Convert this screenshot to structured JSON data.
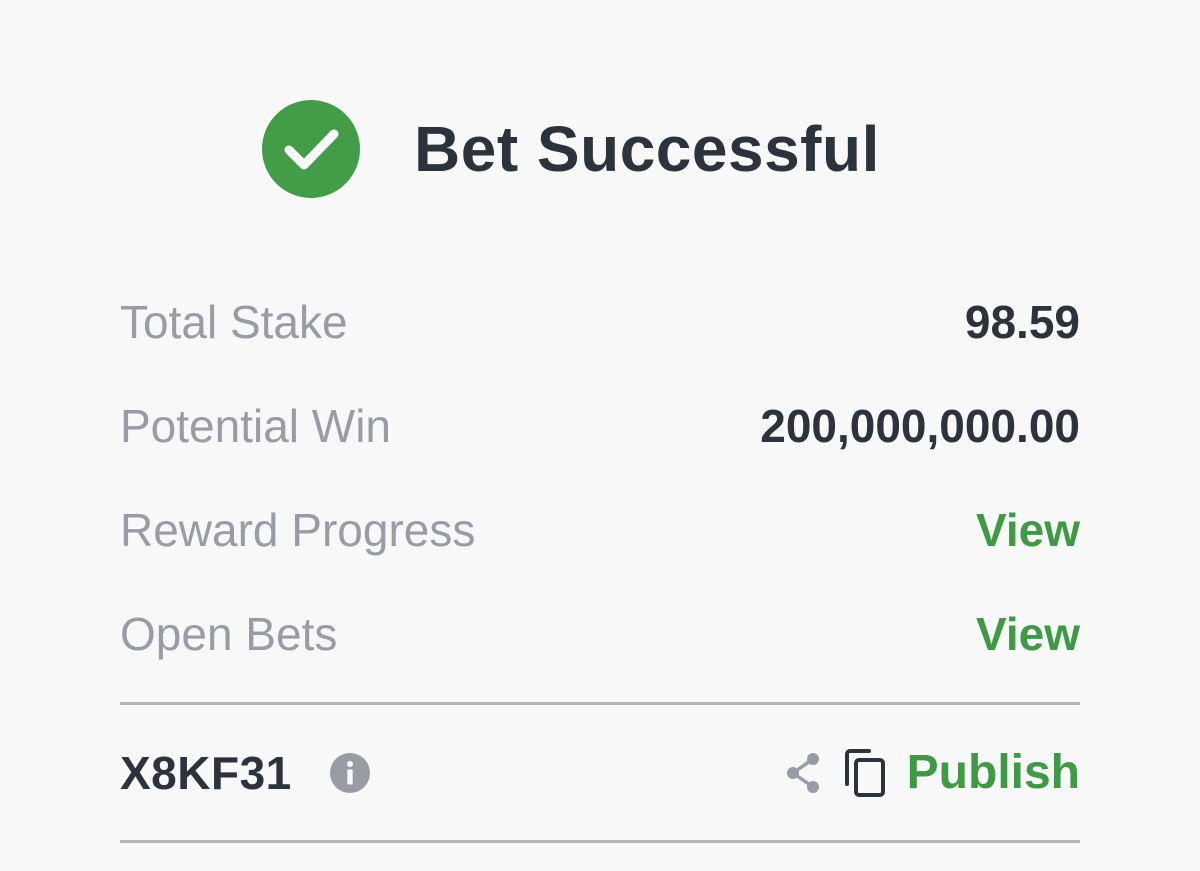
{
  "colors": {
    "accent": "#3e9a45",
    "text_dark": "#2d333d",
    "text_muted": "#9a9ca5",
    "background": "#f8f8f9"
  },
  "header": {
    "icon": "check-circle-icon",
    "title": "Bet Successful"
  },
  "summary": {
    "rows": [
      {
        "label": "Total Stake",
        "value": "98.59"
      },
      {
        "label": "Potential Win",
        "value": "200,000,000.00"
      },
      {
        "label": "Reward Progress",
        "link": "View"
      },
      {
        "label": "Open Bets",
        "link": "View"
      }
    ]
  },
  "footer": {
    "code": "X8KF31",
    "info_icon": "info-icon",
    "share_icon": "share-icon",
    "copy_icon": "copy-icon",
    "publish_label": "Publish"
  }
}
